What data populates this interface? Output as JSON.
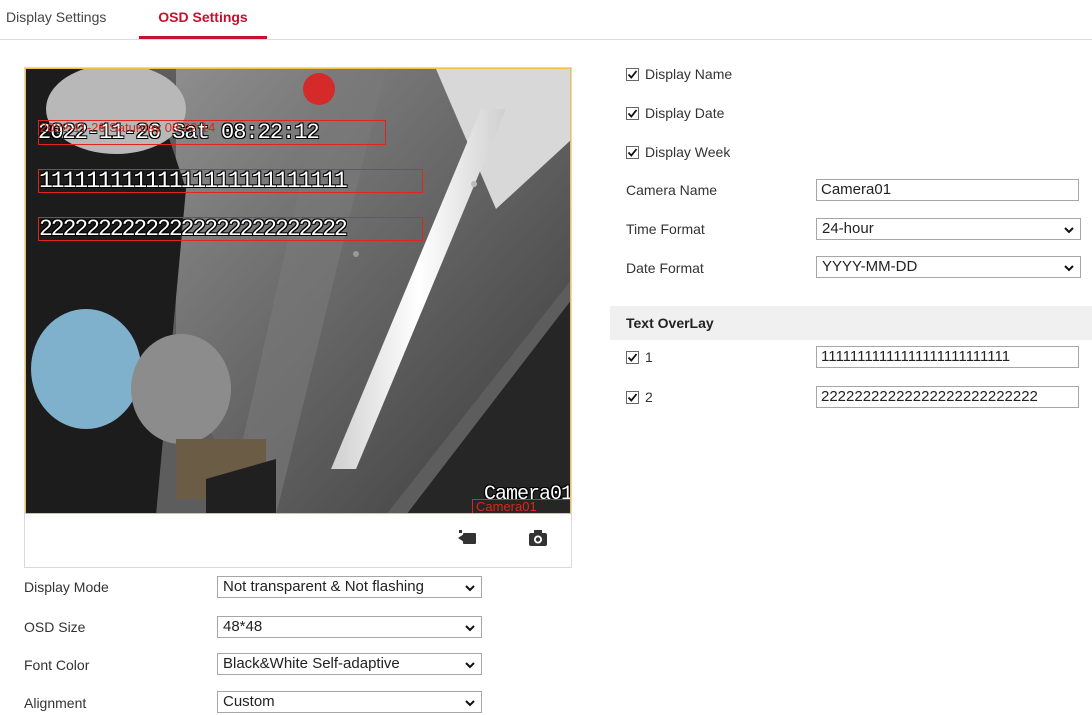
{
  "tabs": [
    {
      "label": "Display Settings",
      "active": false
    },
    {
      "label": "OSD Settings",
      "active": true
    }
  ],
  "accent_color": "#c8102e",
  "preview": {
    "osd_date_overlay": "2022-11-26 Sat 08:22:12",
    "osd_date_small": "2022-11-26 Saturday 08:22:14",
    "osd_line1": "11111111111111111111111111",
    "osd_line2": "22222222222222222222222222",
    "osd_camera_name": "Camera01",
    "osd_camera_small": "Camera01",
    "record_icon": "video-record-icon",
    "snapshot_icon": "camera-snapshot-icon"
  },
  "left_form": {
    "display_mode": {
      "label": "Display Mode",
      "value": "Not transparent & Not flashing"
    },
    "osd_size": {
      "label": "OSD Size",
      "value": "48*48"
    },
    "font_color": {
      "label": "Font Color",
      "value": "Black&White Self-adaptive"
    },
    "alignment": {
      "label": "Alignment",
      "value": "Custom"
    }
  },
  "right_form": {
    "display_name": {
      "label": "Display Name",
      "checked": true
    },
    "display_date": {
      "label": "Display Date",
      "checked": true
    },
    "display_week": {
      "label": "Display Week",
      "checked": true
    },
    "camera_name": {
      "label": "Camera Name",
      "value": "Camera01"
    },
    "time_format": {
      "label": "Time Format",
      "value": "24-hour"
    },
    "date_format": {
      "label": "Date Format",
      "value": "YYYY-MM-DD"
    }
  },
  "text_overlay": {
    "title": "Text OverLay",
    "items": [
      {
        "index": "1",
        "checked": true,
        "value": "11111111111111111111111111"
      },
      {
        "index": "2",
        "checked": true,
        "value": "22222222222222222222222222"
      }
    ]
  }
}
